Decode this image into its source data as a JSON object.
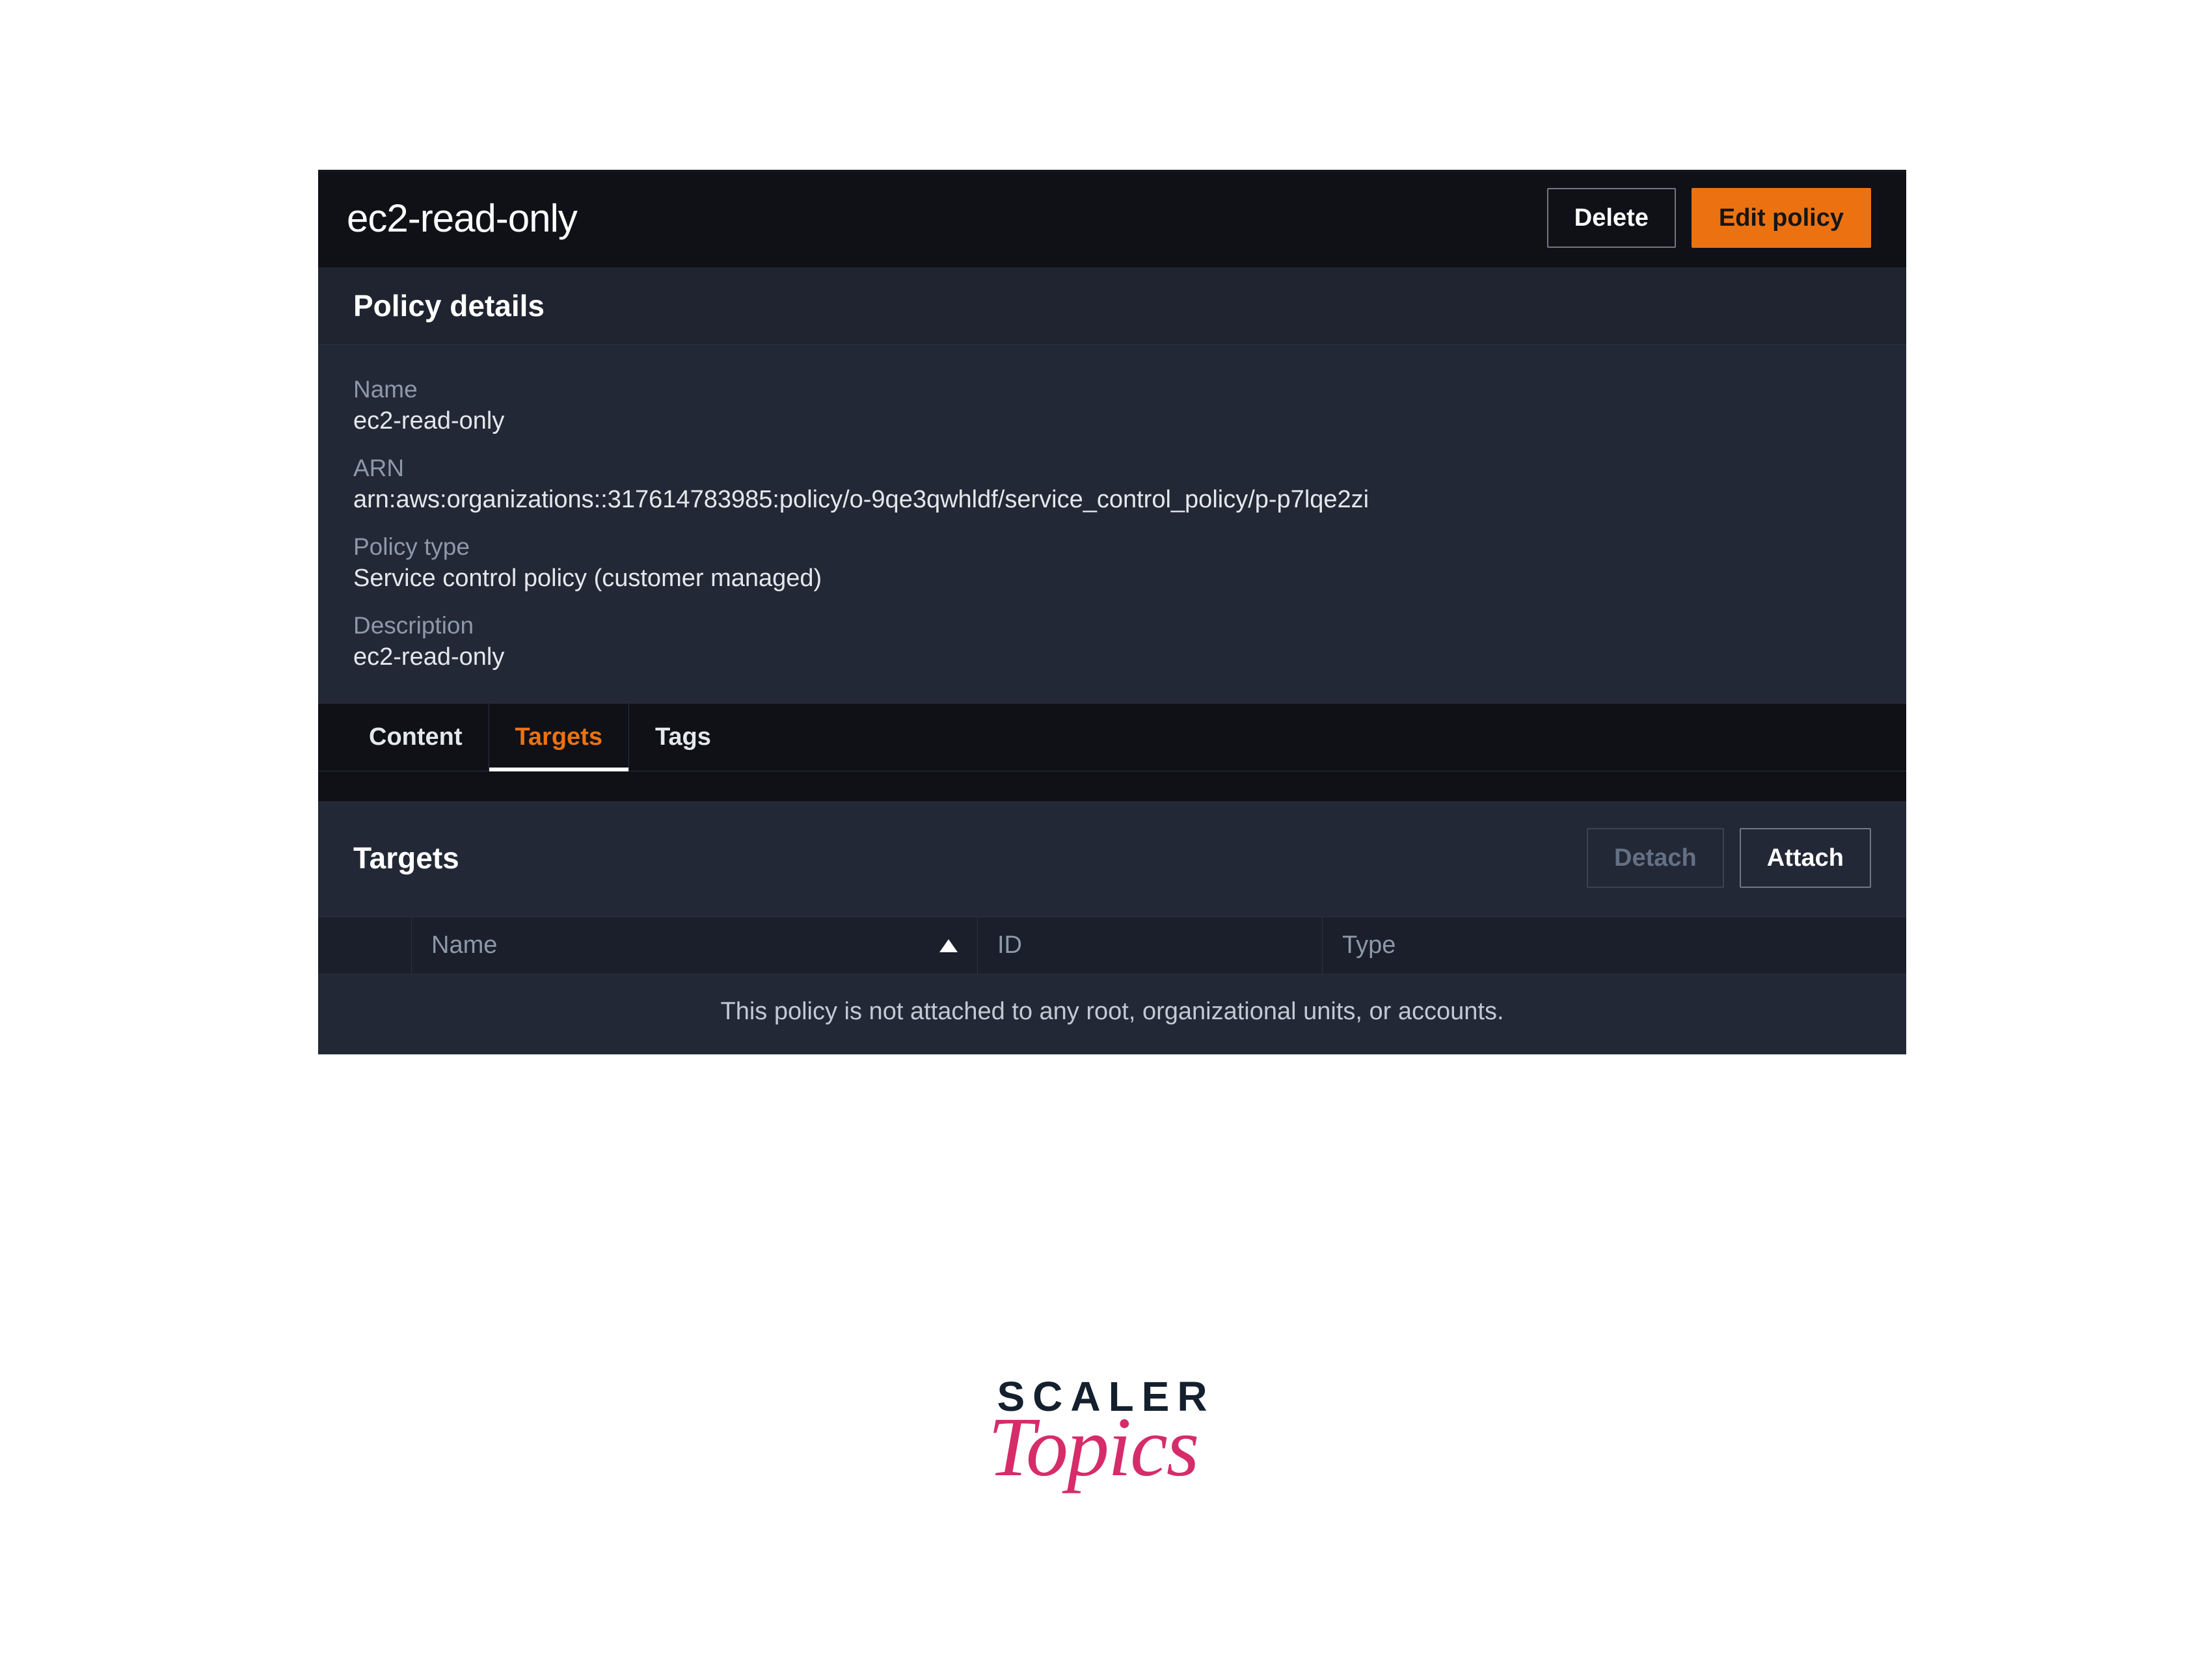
{
  "header": {
    "title": "ec2-read-only",
    "delete_label": "Delete",
    "edit_label": "Edit policy"
  },
  "details": {
    "panel_title": "Policy details",
    "name_label": "Name",
    "name_value": "ec2-read-only",
    "arn_label": "ARN",
    "arn_value": "arn:aws:organizations::317614783985:policy/o-9qe3qwhldf/service_control_policy/p-p7lqe2zi",
    "type_label": "Policy type",
    "type_value": "Service control policy (customer managed)",
    "desc_label": "Description",
    "desc_value": "ec2-read-only"
  },
  "tabs": {
    "content": "Content",
    "targets": "Targets",
    "tags": "Tags"
  },
  "targets": {
    "section_title": "Targets",
    "detach_label": "Detach",
    "attach_label": "Attach",
    "col_name": "Name",
    "col_id": "ID",
    "col_type": "Type",
    "empty_message": "This policy is not attached to any root, organizational units, or accounts."
  },
  "brand": {
    "line1": "SCALER",
    "line2": "Topics"
  }
}
